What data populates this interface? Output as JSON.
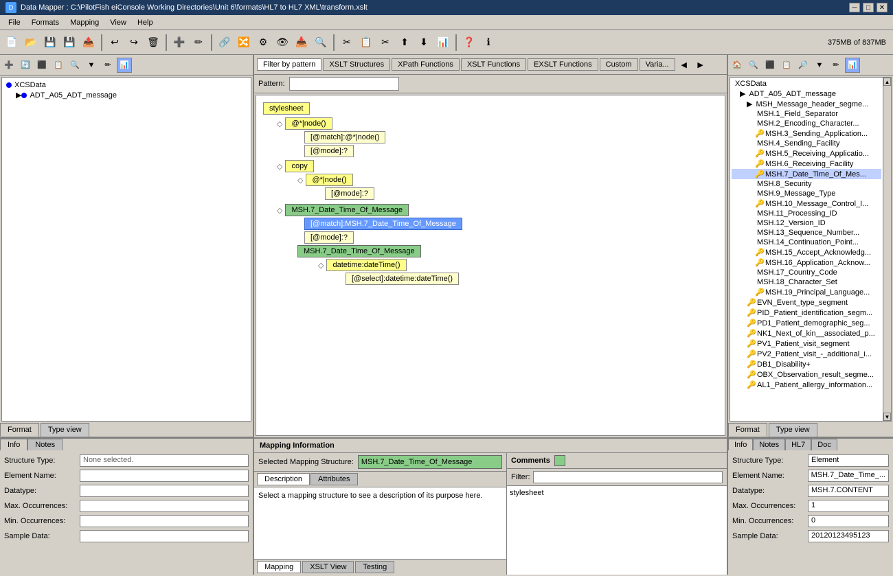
{
  "titleBar": {
    "title": "Data Mapper : C:\\PilotFish eiConsole Working Directories\\Unit 6\\formats\\HL7 to HL7 XML\\transform.xslt",
    "memory": "375MB of 837MB"
  },
  "menu": {
    "items": [
      "File",
      "Formats",
      "Mapping",
      "View",
      "Help"
    ]
  },
  "filterTabs": {
    "tabs": [
      "Filter by pattern",
      "XSLT Structures",
      "XPath Functions",
      "XSLT Functions",
      "EXSLT Functions",
      "Custom",
      "Varia..."
    ],
    "activeTab": "Filter by pattern",
    "patternLabel": "Pattern:"
  },
  "leftTree": {
    "root": "XCSData",
    "items": [
      {
        "label": "ADT_A05_ADT_message",
        "level": 1,
        "expanded": true
      }
    ]
  },
  "leftTabs": {
    "tabs": [
      "Format",
      "Type view"
    ],
    "activeTab": "Format"
  },
  "leftInfoTabs": {
    "tabs": [
      "Info",
      "Notes"
    ],
    "activeTab": "Info"
  },
  "leftInfo": {
    "structureTypeLabel": "Structure Type:",
    "structureTypeValue": "None selected.",
    "elementNameLabel": "Element Name:",
    "elementNameValue": "",
    "datatypeLabel": "Datatype:",
    "datatypeValue": "",
    "maxOccurrencesLabel": "Max. Occurrences:",
    "maxOccurrencesValue": "",
    "minOccurrencesLabel": "Min. Occurrences:",
    "minOccurrencesValue": "",
    "sampleDataLabel": "Sample Data:",
    "sampleDataValue": ""
  },
  "xsltNodes": {
    "nodes": [
      {
        "id": "stylesheet",
        "label": "stylesheet",
        "type": "yellow",
        "level": 0
      },
      {
        "id": "node1",
        "label": "@*|node()",
        "type": "yellow",
        "level": 1
      },
      {
        "id": "node2",
        "label": "[@match]:@*|node()",
        "type": "light-yellow",
        "level": 2
      },
      {
        "id": "node3",
        "label": "[@mode]:?",
        "type": "light-yellow",
        "level": 2
      },
      {
        "id": "node4",
        "label": "copy",
        "type": "yellow",
        "level": 1
      },
      {
        "id": "node5",
        "label": "@*|node()",
        "type": "yellow",
        "level": 2
      },
      {
        "id": "node6",
        "label": "[@mode]:?",
        "type": "light-yellow",
        "level": 3
      },
      {
        "id": "node7",
        "label": "MSH.7_Date_Time_Of_Message",
        "type": "green",
        "level": 1
      },
      {
        "id": "node8",
        "label": "[@match]:MSH.7_Date_Time_Of_Message",
        "type": "selected",
        "level": 2
      },
      {
        "id": "node9",
        "label": "[@mode]:?",
        "type": "light-yellow",
        "level": 2
      },
      {
        "id": "node10",
        "label": "MSH.7_Date_Time_Of_Message",
        "type": "green",
        "level": 2
      },
      {
        "id": "node11",
        "label": "datetime:dateTime()",
        "type": "yellow",
        "level": 3
      },
      {
        "id": "node12",
        "label": "[@select]:datetime:dateTime()",
        "type": "light-yellow",
        "level": 4
      }
    ]
  },
  "mappingInfo": {
    "header": "Mapping Information",
    "selectedMappingLabel": "Selected Mapping Structure:",
    "selectedMappingValue": "MSH.7_Date_Time_Of_Message",
    "descriptionText": "Select a mapping structure to see a description of its purpose here.",
    "subTabs": [
      "Description",
      "Attributes"
    ],
    "activeSubTab": "Description",
    "bottomTabs": [
      "Mapping",
      "XSLT View",
      "Testing"
    ],
    "activeBottomTab": "Mapping"
  },
  "comments": {
    "header": "Comments",
    "filterLabel": "Filter:",
    "filterValue": "",
    "items": [
      "stylesheet"
    ]
  },
  "rightTree": {
    "root": "XCSData",
    "items": [
      {
        "label": "ADT_A05_ADT_message",
        "level": 1,
        "expanded": true
      },
      {
        "label": "MSH_Message_header_segme...",
        "level": 2,
        "expanded": true
      },
      {
        "label": "MSH.1_Field_Separator",
        "level": 3
      },
      {
        "label": "MSH.2_Encoding_Character...",
        "level": 3
      },
      {
        "label": "MSH.3_Sending_Application...",
        "level": 3
      },
      {
        "label": "MSH.4_Sending_Facility",
        "level": 3
      },
      {
        "label": "MSH.5_Receiving_Applicatio...",
        "level": 3
      },
      {
        "label": "MSH.6_Receiving_Facility",
        "level": 3
      },
      {
        "label": "MSH.7_Date_Time_Of_Mes...",
        "level": 3,
        "selected": true
      },
      {
        "label": "MSH.8_Security",
        "level": 3
      },
      {
        "label": "MSH.9_Message_Type",
        "level": 3
      },
      {
        "label": "MSH.10_Message_Control_I...",
        "level": 3
      },
      {
        "label": "MSH.11_Processing_ID",
        "level": 3
      },
      {
        "label": "MSH.12_Version_ID",
        "level": 3
      },
      {
        "label": "MSH.13_Sequence_Number...",
        "level": 3
      },
      {
        "label": "MSH.14_Continuation_Point...",
        "level": 3
      },
      {
        "label": "MSH.15_Accept_Acknowledg...",
        "level": 3
      },
      {
        "label": "MSH.16_Application_Acknow...",
        "level": 3
      },
      {
        "label": "MSH.17_Country_Code",
        "level": 3
      },
      {
        "label": "MSH.18_Character_Set",
        "level": 3
      },
      {
        "label": "MSH.19_Principal_Language...",
        "level": 3
      },
      {
        "label": "EVN_Event_type_segment",
        "level": 2
      },
      {
        "label": "PID_Patient_identification_segm...",
        "level": 2
      },
      {
        "label": "PD1_Patient_demographic_seg...",
        "level": 2
      },
      {
        "label": "NK1_Next_of_kin__associated_p...",
        "level": 2
      },
      {
        "label": "PV1_Patient_visit_segment",
        "level": 2
      },
      {
        "label": "PV2_Patient_visit_-_additional_i...",
        "level": 2
      },
      {
        "label": "DB1_Disability+",
        "level": 2
      },
      {
        "label": "OBX_Observation_result_segme...",
        "level": 2
      },
      {
        "label": "AL1_Patient_allergy_information...",
        "level": 2
      }
    ]
  },
  "rightTabs": {
    "tabs": [
      "Format",
      "Type view"
    ],
    "activeTab": "Format"
  },
  "rightInfoTabs": {
    "tabs": [
      "Info",
      "Notes",
      "HL7",
      "Doc"
    ],
    "activeTab": "Info"
  },
  "rightInfo": {
    "structureTypeLabel": "Structure Type:",
    "structureTypeValue": "Element",
    "elementNameLabel": "Element Name:",
    "elementNameValue": "MSH.7_Date_Time_...",
    "datatypeLabel": "Datatype:",
    "datatypeValue": "MSH.7.CONTENT",
    "maxOccurrencesLabel": "Max. Occurrences:",
    "maxOccurrencesValue": "1",
    "minOccurrencesLabel": "Min. Occurrences:",
    "minOccurrencesValue": "0",
    "sampleDataLabel": "Sample Data:",
    "sampleDataValue": "20120123495123"
  }
}
